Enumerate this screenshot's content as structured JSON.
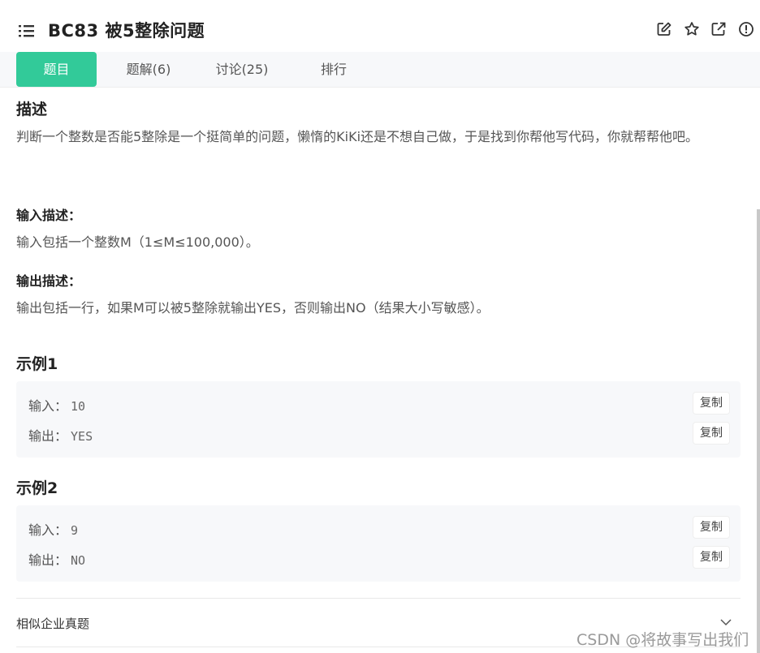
{
  "header": {
    "title": "BC83  被5整除问题",
    "icons": [
      "list-icon",
      "edit-icon",
      "star-icon",
      "external-link-icon",
      "info-icon"
    ]
  },
  "tabs": [
    {
      "label": "题目",
      "active": true
    },
    {
      "label": "题解(6)",
      "active": false
    },
    {
      "label": "讨论(25)",
      "active": false
    },
    {
      "label": "排行",
      "active": false
    }
  ],
  "description": {
    "heading": "描述",
    "text": "判断一个整数是否能5整除是一个挺简单的问题，懒惰的KiKi还是不想自己做，于是找到你帮他写代码，你就帮帮他吧。"
  },
  "input_desc": {
    "heading": "输入描述：",
    "text": "输入包括一个整数M（1≤M≤100,000）。"
  },
  "output_desc": {
    "heading": "输出描述：",
    "text": "输出包括一行，如果M可以被5整除就输出YES，否则输出NO（结果大小写敏感）。"
  },
  "examples": [
    {
      "heading": "示例1",
      "input_label": "输入：",
      "input": "10",
      "output_label": "输出：",
      "output": "YES",
      "copy_label": "复制"
    },
    {
      "heading": "示例2",
      "input_label": "输入：",
      "input": "9",
      "output_label": "输出：",
      "output": "NO",
      "copy_label": "复制"
    }
  ],
  "related": {
    "label": "相似企业真题"
  },
  "watermark": "CSDN @将故事写出我们",
  "colors": {
    "accent": "#32ca99",
    "panel": "#f7f8fa",
    "text": "#333333"
  }
}
